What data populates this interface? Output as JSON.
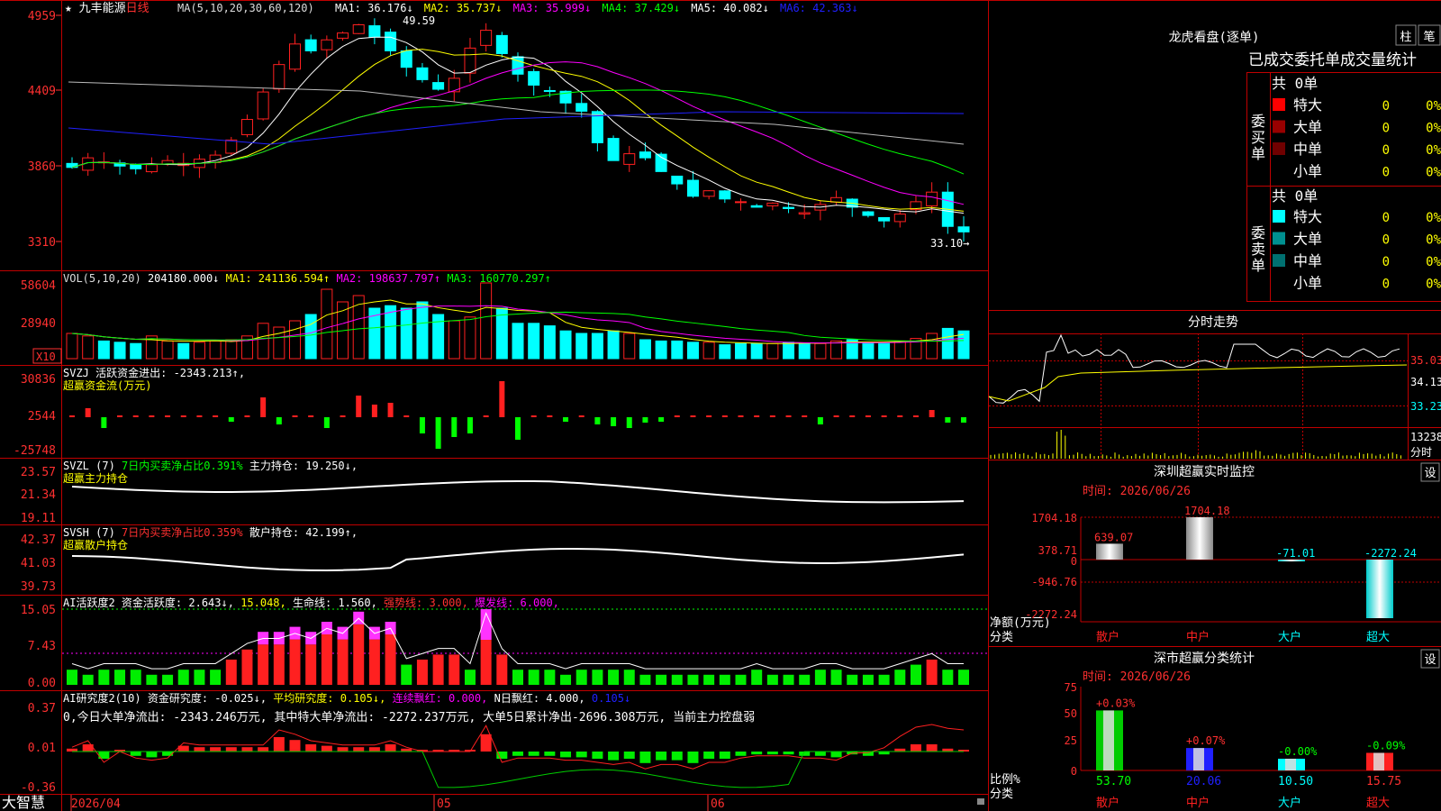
{
  "stock": {
    "star": "★",
    "name": "九丰能源",
    "period": "日线"
  },
  "colors": {
    "up": "#ff2020",
    "down": "#00ffff",
    "panel_border": "#c00000",
    "green": "#00ff00",
    "magenta": "#ff00ff",
    "yellow": "#ffff00",
    "white": "#ffffff",
    "blue": "#2020ff"
  },
  "price_panel": {
    "ma_header": "MA(5,10,20,30,60,120)",
    "ma": [
      {
        "label": "MA1:",
        "value": "36.176",
        "arrow": "↓"
      },
      {
        "label": "MA2:",
        "value": "35.737",
        "arrow": "↓"
      },
      {
        "label": "MA3:",
        "value": "35.999",
        "arrow": "↓"
      },
      {
        "label": "MA4:",
        "value": "37.429",
        "arrow": "↓"
      },
      {
        "label": "MA5:",
        "value": "40.082",
        "arrow": "↓"
      },
      {
        "label": "MA6:",
        "value": "42.363",
        "arrow": "↓"
      }
    ],
    "y_ticks": [
      "4959",
      "4409",
      "3860",
      "3310"
    ],
    "high_marker": "49.59",
    "low_marker": "33.10→"
  },
  "vol_panel": {
    "header": "VOL(5,10,20)",
    "value": "204180.000↓",
    "ma1": "MA1: 241136.594↑",
    "ma2": "MA2: 198637.797↑",
    "ma3": "MA3: 160770.297↑",
    "y_ticks": [
      "58604",
      "28940"
    ],
    "unit": "X10"
  },
  "svzj_panel": {
    "header": "SVZJ  活跃资金进出: -2343.213↑,",
    "subheader": "超赢资金流(万元)",
    "y_ticks": [
      "30836",
      "2544",
      "-25748"
    ]
  },
  "svzl_panel": {
    "header": "SVZL (7)",
    "ratio": "7日内买卖净占比0.391%",
    "holding": "主力持仓: 19.250↓,",
    "subheader": "超赢主力持仓",
    "y_ticks": [
      "23.57",
      "21.34",
      "19.11"
    ]
  },
  "svsh_panel": {
    "header": "SVSH (7)",
    "ratio": "7日内买卖净占比0.359%",
    "holding": "散户持仓: 42.199↑,",
    "subheader": "超赢散户持仓",
    "y_ticks": [
      "42.37",
      "41.03",
      "39.73"
    ]
  },
  "ai_active": {
    "header": "AI活跃度2",
    "active": "资金活跃度: 2.643↓,",
    "v2": "15.048,",
    "life": "生命线: 1.560,",
    "strong": "强势线: 3.000,",
    "burst": "爆发线: 6.000,",
    "y_ticks": [
      "15.05",
      "7.43",
      "0.00"
    ]
  },
  "ai_research": {
    "header": "AI研究度2(10)",
    "research": "资金研究度: -0.025↓,",
    "avg": "平均研究度: 0.105↓,",
    "cont": "连续飘红: 0.000,",
    "nday": "N日飘红: 4.000,",
    "last": "0.105↓",
    "commentary": "0,今日大单净流出: -2343.246万元, 其中特大单净流出: -2272.237万元, 大单5日累计净出-2696.308万元, 当前主力控盘弱",
    "y_ticks": [
      "0.37",
      "0.01",
      "-0.36"
    ]
  },
  "x_axis": {
    "logo": "大智慧",
    "labels": [
      "2026/04",
      "05",
      "06"
    ]
  },
  "dragon": {
    "title": "龙虎看盘(逐单)",
    "btn1": "柱",
    "btn2": "笔",
    "subtitle": "已成交委托单成交量统计",
    "buy_label": "委买单",
    "sell_label": "委卖单",
    "buy_total": "共 0单",
    "sell_total": "共 0单",
    "buy_rows": [
      {
        "name": "特大",
        "count": "0",
        "pct": "0%",
        "color": "#ff0000"
      },
      {
        "name": "大单",
        "count": "0",
        "pct": "0%",
        "color": "#990000"
      },
      {
        "name": "中单",
        "count": "0",
        "pct": "0%",
        "color": "#700000"
      },
      {
        "name": "小单",
        "count": "0",
        "pct": "0%",
        "color": ""
      }
    ],
    "sell_rows": [
      {
        "name": "特大",
        "count": "0",
        "pct": "0%",
        "color": "#00ffff"
      },
      {
        "name": "大单",
        "count": "0",
        "pct": "0%",
        "color": "#009090"
      },
      {
        "name": "中单",
        "count": "0",
        "pct": "0%",
        "color": "#007070"
      },
      {
        "name": "小单",
        "count": "0",
        "pct": "0%",
        "color": ""
      }
    ]
  },
  "intraday": {
    "title": "分时走势",
    "y_ticks": [
      "35.03",
      "34.13",
      "33.23"
    ],
    "vol_tick": "13238",
    "label": "分时"
  },
  "sz_monitor": {
    "title": "深圳超赢实时监控",
    "btn": "设",
    "time": "时间: 2026/06/26",
    "y_ticks": [
      "1704.18",
      "378.71",
      "0",
      "-946.76",
      "-2272.24"
    ],
    "ylabel": "净额(万元)",
    "xlabel": "分类",
    "bars": [
      {
        "cat": "散户",
        "value": 639.07,
        "label": "639.07",
        "cat_color": "#ff2020"
      },
      {
        "cat": "中户",
        "value": 1704.18,
        "label": "1704.18",
        "cat_color": "#ff2020"
      },
      {
        "cat": "大户",
        "value": -71.01,
        "label": "-71.01",
        "cat_color": "#00ffff"
      },
      {
        "cat": "超大",
        "value": -2272.24,
        "label": "-2272.24",
        "cat_color": "#00ffff"
      }
    ]
  },
  "sz_class": {
    "title": "深市超赢分类统计",
    "btn": "设",
    "time": "时间: 2026/06/26",
    "y_ticks": [
      "75",
      "50",
      "25",
      "0"
    ],
    "ylabel": "比例%",
    "xlabel": "分类",
    "bars": [
      {
        "cat": "散户",
        "value": 53.7,
        "label": "53.70",
        "delta": "+0.03%",
        "color": "#00cc00",
        "cat_color": "#ff2020"
      },
      {
        "cat": "中户",
        "value": 20.06,
        "label": "20.06",
        "delta": "+0.07%",
        "color": "#2020ff",
        "cat_color": "#ff2020"
      },
      {
        "cat": "大户",
        "value": 10.5,
        "label": "10.50",
        "delta": "-0.00%",
        "color": "#00ffff",
        "cat_color": "#00ffff"
      },
      {
        "cat": "超大",
        "value": 15.75,
        "label": "15.75",
        "delta": "-0.09%",
        "color": "#ff2020",
        "cat_color": "#ff2020"
      }
    ]
  }
}
